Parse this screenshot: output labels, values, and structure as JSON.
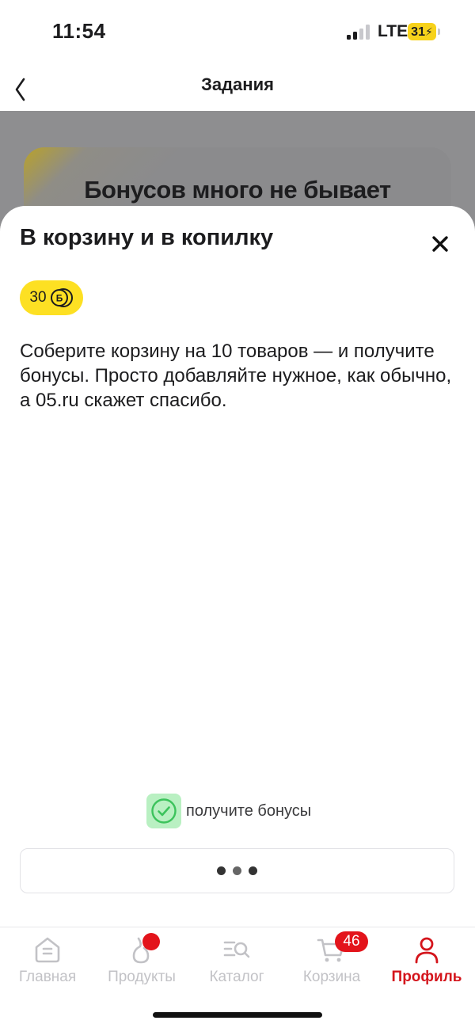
{
  "status_bar": {
    "time": "11:54",
    "network": "LTE",
    "battery": "31"
  },
  "header": {
    "title": "Задания"
  },
  "background_card": {
    "title": "Бонусов много не бывает"
  },
  "sheet": {
    "title": "В корзину и в копилку",
    "bonus_amount": "30",
    "bonus_currency_symbol": "Б",
    "description": "Соберите корзину на 10 товаров — и получите бонусы. Просто добавляйте нужное, как обычно, а 05.ru скажет спасибо.",
    "status_label": "получите бонусы"
  },
  "tab_bar": {
    "tabs": [
      {
        "label": "Главная",
        "icon": "home-icon",
        "active": false
      },
      {
        "label": "Продукты",
        "icon": "products-icon",
        "active": false
      },
      {
        "label": "Каталог",
        "icon": "catalog-search-icon",
        "active": false
      },
      {
        "label": "Корзина",
        "icon": "cart-icon",
        "active": false,
        "badge": "46"
      },
      {
        "label": "Профиль",
        "icon": "profile-icon",
        "active": true
      }
    ]
  },
  "colors": {
    "accent_yellow": "#fde023",
    "active_red": "#d4151c",
    "badge_red": "#e3141b",
    "success_green": "#3cc35c",
    "inactive_gray": "#c2c2c6"
  }
}
